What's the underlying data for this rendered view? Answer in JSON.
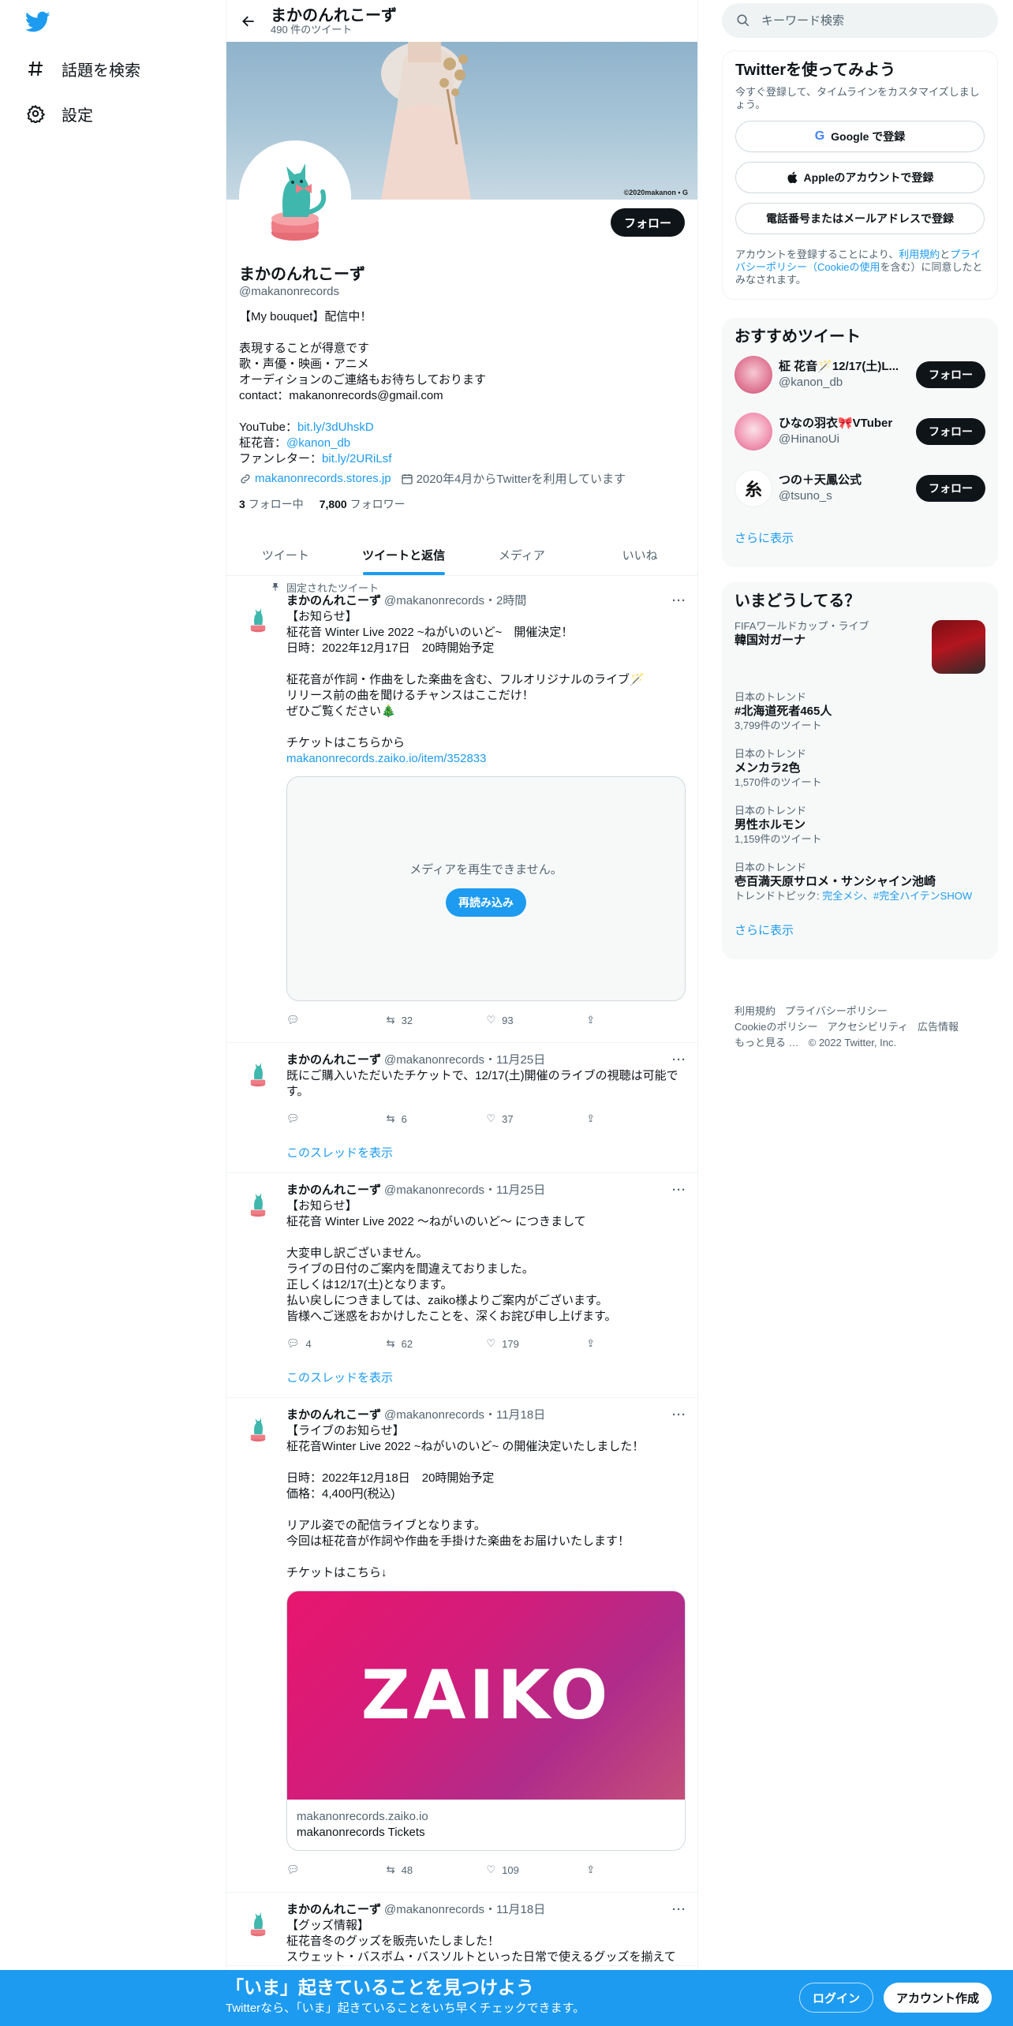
{
  "nav": {
    "items": [
      {
        "label": "話題を検索",
        "icon": "hashtag-icon"
      },
      {
        "label": "設定",
        "icon": "gear-icon"
      }
    ]
  },
  "header": {
    "title": "まかのんれこーず",
    "subtitle": "490 件のツイート"
  },
  "banner": {
    "copyright": "©2020makanon • G"
  },
  "profile": {
    "follow_label": "フォロー",
    "name": "まかのんれこーず",
    "handle": "@makanonrecords",
    "bio": [
      "【My bouquet】配信中！",
      "",
      "表現することが得意です",
      "歌・声優・映画・アニメ",
      "オーディションのご連絡もお待ちしております",
      "contact：makanonrecords@gmail.com",
      ""
    ],
    "youtube_label": "YouTube：",
    "youtube_link": "bit.ly/3dUhskD",
    "kanon_label": "柾花音：",
    "kanon_link": "@kanon_db",
    "fan_label": "ファンレター：",
    "fan_link": "bit.ly/2URiLsf",
    "website": "makanonrecords.stores.jp",
    "joined": "2020年4月からTwitterを利用しています",
    "following_count": "3",
    "following_label": "フォロー中",
    "followers_count": "7,800",
    "followers_label": "フォロワー"
  },
  "tabs": [
    "ツイート",
    "ツイートと返信",
    "メディア",
    "いいね"
  ],
  "tweets": [
    {
      "pinned_label": "固定されたツイート",
      "name": "まかのんれこーず",
      "meta": "@makanonrecords・2時間",
      "lines": [
        "【お知らせ】",
        "柾花音 Winter Live 2022 ~ねがいのいど~　開催決定！",
        "日時：2022年12月17日　20時開始予定",
        "",
        "柾花音が作詞・作曲をした楽曲を含む、フルオリジナルのライブ🪄",
        "リリース前の曲を聞けるチャンスはここだけ！",
        "ぜひご覧ください🎄",
        "",
        "チケットはこちらから"
      ],
      "link": "makanonrecords.zaiko.io/item/352833",
      "media_message": "メディアを再生できません。",
      "reload_label": "再読み込み",
      "reply": "",
      "retweet": "32",
      "like": "93"
    },
    {
      "name": "まかのんれこーず",
      "meta": "@makanonrecords・11月25日",
      "lines": [
        "既にご購入いただいたチケットで、12/17(土)開催のライブの視聴は可能で",
        "す。"
      ],
      "reply": "",
      "retweet": "6",
      "like": "37",
      "thread_label": "このスレッドを表示"
    },
    {
      "name": "まかのんれこーず",
      "meta": "@makanonrecords・11月25日",
      "lines": [
        "【お知らせ】",
        "柾花音 Winter Live 2022 ～ねがいのいど～ につきまして",
        "",
        "大変申し訳ございません。",
        "ライブの日付のご案内を間違えておりました。",
        "正しくは12/17(土)となります。",
        "払い戻しにつきましては、zaiko様よりご案内がございます。",
        "皆様へご迷惑をおかけしたことを、深くお詫び申し上げます。"
      ],
      "reply": "4",
      "retweet": "62",
      "like": "179",
      "thread_label": "このスレッドを表示"
    },
    {
      "name": "まかのんれこーず",
      "meta": "@makanonrecords・11月18日",
      "lines": [
        "【ライブのお知らせ】",
        "柾花音Winter Live 2022 ~ねがいのいど~ の開催決定いたしました！",
        "",
        "日時：2022年12月18日　20時開始予定",
        "価格：4,400円(税込)",
        "",
        "リアル姿での配信ライブとなります。",
        "今回は柾花音が作詞や作曲を手掛けた楽曲をお届けいたします！",
        "",
        "チケットはこちら↓"
      ],
      "card_logo": "ZAIKO",
      "card_domain": "makanonrecords.zaiko.io",
      "card_title": "makanonrecords Tickets",
      "reply": "",
      "retweet": "48",
      "like": "109"
    },
    {
      "name": "まかのんれこーず",
      "meta": "@makanonrecords・11月18日",
      "lines": [
        "【グッズ情報】",
        "柾花音冬のグッズを販売いたしました！",
        "スウェット・バスボム・バスソルトといった日常で使えるグッズを揃えて"
      ]
    }
  ],
  "search": {
    "placeholder": "キーワード検索"
  },
  "signup": {
    "title": "Twitterを使ってみよう",
    "desc": "今すぐ登録して、タイムラインをカスタマイズしましょう。",
    "google": "Google で登録",
    "apple": "Appleのアカウントで登録",
    "phone": "電話番号またはメールアドレスで登録",
    "terms_a": "アカウントを登録することにより、",
    "terms_link1": "利用規約",
    "terms_b": "と",
    "terms_link2": "プライバシーポリシー（Cookieの使用",
    "terms_c": "を含む）に同意したとみなされます。"
  },
  "recommended": {
    "title": "おすすめツイート",
    "items": [
      {
        "name": "柾 花音🪄12/17(土)L...",
        "handle": "@kanon_db",
        "follow": "フォロー"
      },
      {
        "name": "ひなの羽衣🎀VTuber",
        "handle": "@HinanoUi",
        "follow": "フォロー"
      },
      {
        "name": "つの＋天鳳公式",
        "handle": "@tsuno_s",
        "follow": "フォロー"
      }
    ],
    "show_more": "さらに表示"
  },
  "trends": {
    "title": "いまどうしてる？",
    "items": [
      {
        "category": "FIFAワールドカップ・ライブ",
        "name": "韓国対ガーナ",
        "tweets": ""
      },
      {
        "category": "日本のトレンド",
        "name": "#北海道死者465人",
        "tweets": "3,799件のツイート"
      },
      {
        "category": "日本のトレンド",
        "name": "メンカラ2色",
        "tweets": "1,570件のツイート"
      },
      {
        "category": "日本のトレンド",
        "name": "男性ホルモン",
        "tweets": "1,159件のツイート"
      },
      {
        "category": "日本のトレンド",
        "name": "壱百満天原サロメ・サンシャイン池崎",
        "tweets": ""
      }
    ],
    "topic_label": "トレンドトピック: ",
    "topic_links": "完全メシ、#完全ハイテンSHOW",
    "show_more": "さらに表示"
  },
  "footer": {
    "line1": [
      "利用規約",
      "プライバシーポリシー"
    ],
    "line2": [
      "Cookieのポリシー",
      "アクセシビリティ",
      "広告情報"
    ],
    "line3": [
      "もっと見る …",
      "© 2022 Twitter, Inc."
    ]
  },
  "bottom": {
    "title": "「いま」起きていることを見つけよう",
    "subtitle": "Twitterなら、「いま」起きていることをいち早くチェックできます。",
    "login": "ログイン",
    "signup": "アカウント作成"
  },
  "colors": {
    "accent": "#1d9bf0",
    "text": "#0f1419",
    "muted": "#536471"
  }
}
